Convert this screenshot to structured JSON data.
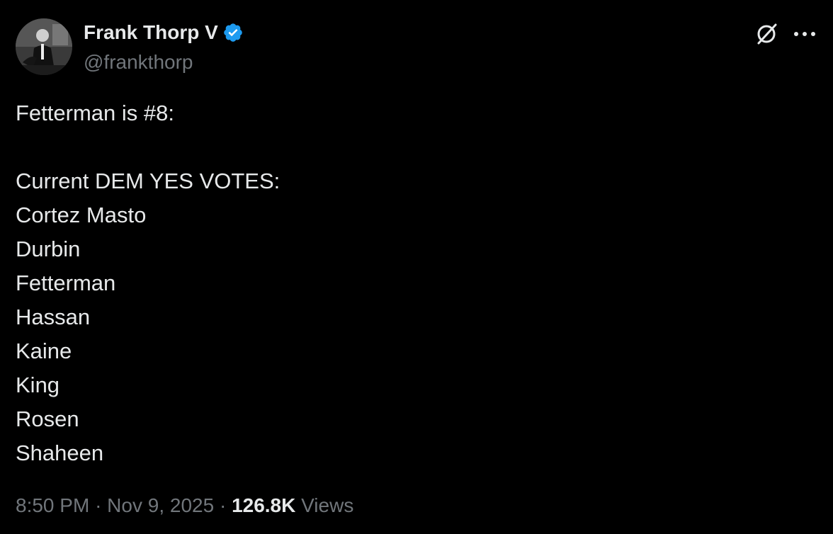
{
  "author": {
    "name": "Frank Thorp V",
    "handle": "@frankthorp",
    "verified": true,
    "verified_color": "#1d9bf0"
  },
  "actions": {
    "grok_icon": "grok-icon",
    "more_icon": "more-icon"
  },
  "tweet": {
    "intro": "Fetterman is #8:",
    "list_header": "Current DEM YES VOTES:",
    "names": [
      "Cortez Masto",
      "Durbin",
      "Fetterman",
      "Hassan",
      "Kaine",
      "King",
      "Rosen",
      "Shaheen"
    ]
  },
  "meta": {
    "time": "8:50 PM",
    "separator": "·",
    "date": "Nov 9, 2025",
    "views_count": "126.8K",
    "views_label": "Views"
  },
  "colors": {
    "background": "#000000",
    "text_primary": "#e7e9ea",
    "text_secondary": "#71767b"
  }
}
